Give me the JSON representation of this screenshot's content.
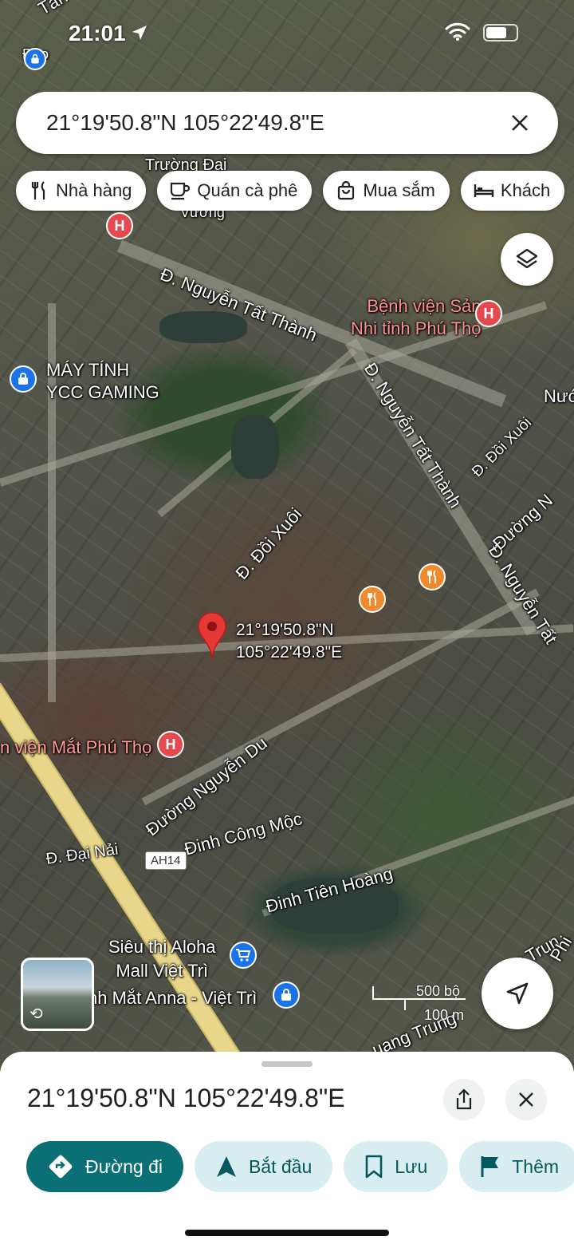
{
  "status": {
    "time": "21:01"
  },
  "search": {
    "query": "21°19'50.8\"N 105°22'49.8\"E"
  },
  "chips": [
    {
      "icon": "fork-knife-icon",
      "label": "Nhà hàng"
    },
    {
      "icon": "coffee-icon",
      "label": "Quán cà phê"
    },
    {
      "icon": "shopping-bag-icon",
      "label": "Mua sắm"
    },
    {
      "icon": "bed-icon",
      "label": "Khách"
    }
  ],
  "map": {
    "labels": {
      "tan": "Tân",
      "dao": "Đảo",
      "truong_dai": "Trường Đại",
      "vuong": "Vương",
      "nguyen_tat_thanh_1": "Đ. Nguyễn Tất Thành",
      "nguyen_tat_thanh_2": "Đ. Nguyễn Tất Thành",
      "nguyen_tat_thanh_3": "Đ. Nguyễn Tất",
      "benh_vien_san": "Bệnh viện Sản\nNhi tỉnh Phú Thọ",
      "may_tinh": "MÁY TÍNH\nYCC GAMING",
      "doi_xuoi_1": "Đ. Đồi Xuôi",
      "doi_xuoi_2": "Đ. Đồi Xuôi",
      "duong_n": "Đường N",
      "nuoc": "Nướ",
      "pin_coords": "21°19'50.8\"N\n105°22'49.8\"E",
      "mat_phu_tho": "n viện Mắt Phú Thọ",
      "nguyen_du": "Đường Nguyễn Du",
      "dinh_cong_moc": "Đinh Công Mộc",
      "dai_nai": "Đ. Đại Nải",
      "ah14": "AH14",
      "dinh_tien_hoang": "Đinh Tiên Hoàng",
      "sieu_thi": "Siêu thị Aloha\nMall Việt Trì",
      "mat_anna": "nh Mắt Anna - Việt Trì",
      "trung": "g Trun",
      "phu": "Phi",
      "quang_trung": "uang Trung"
    },
    "scale": {
      "top": "500 bộ",
      "bottom": "100 m"
    }
  },
  "sheet": {
    "coords": "21°19'50.8\"N 105°22'49.8\"E",
    "actions": [
      {
        "icon": "directions-icon",
        "label": "Đường đi"
      },
      {
        "icon": "navigation-arrow-icon",
        "label": "Bắt đầu"
      },
      {
        "icon": "bookmark-icon",
        "label": "Lưu"
      },
      {
        "icon": "flag-icon",
        "label": "Thêm"
      }
    ]
  },
  "colors": {
    "primary": "#0b6f76",
    "secondary_bg": "#d9eef1",
    "pin_red": "#e5484d",
    "food_orange": "#f08a2c",
    "shop_blue": "#1a73e8"
  }
}
